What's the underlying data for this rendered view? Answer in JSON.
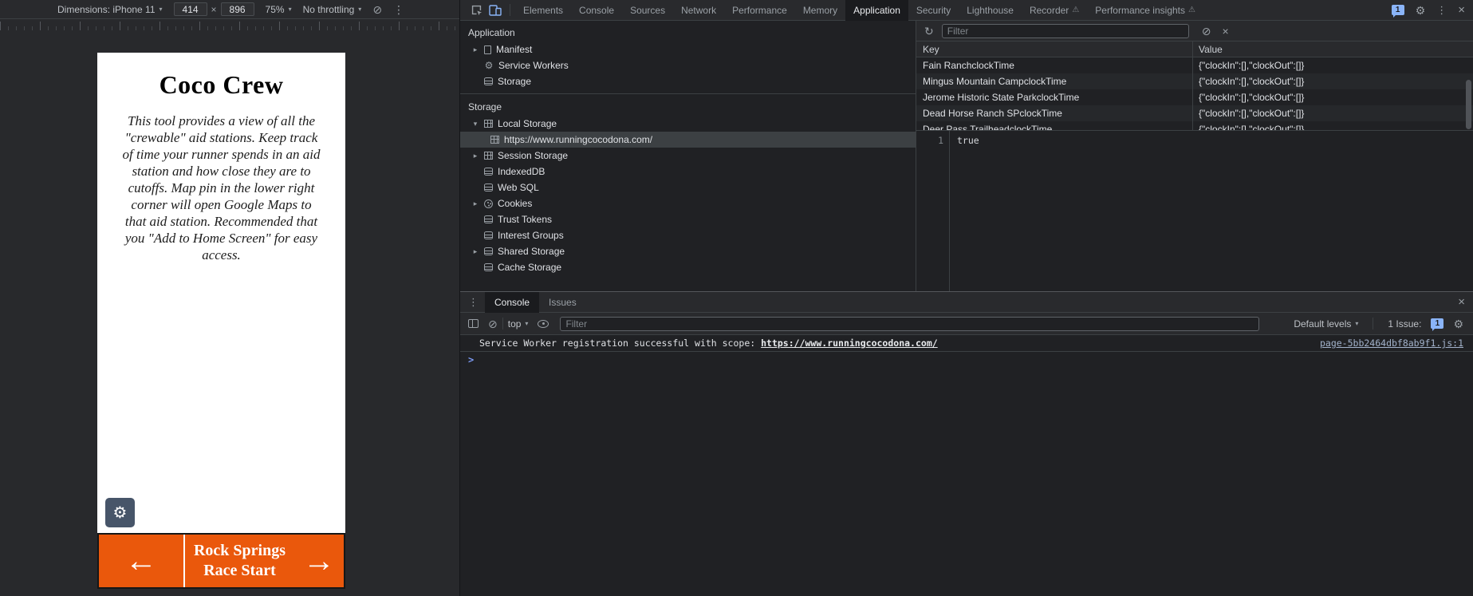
{
  "colors": {
    "accent_orange": "#ea580c",
    "settings_button": "#475569",
    "selection_gray": "#3c4043",
    "issue_badge_blue": "#8ab4f8"
  },
  "device_toolbar": {
    "dimensions_label": "Dimensions: iPhone 11",
    "width_value": "414",
    "multiply_sign": "×",
    "height_value": "896",
    "zoom_value": "75%",
    "throttling_value": "No throttling",
    "caret": "▾",
    "rotate_icon": "⊘",
    "menu_icon": "⋮"
  },
  "phone": {
    "title": "Coco Crew",
    "intro": "This tool provides a view of all the \"crewable\" aid stations. Keep track of time your runner spends in an aid station and how close they are to cutoffs. Map pin in the lower right corner will open Google Maps to that aid station. Recommended that you \"Add to Home Screen\" for easy access.",
    "settings_icon": "⚙",
    "footer": {
      "back_arrow": "←",
      "station_line1": "Rock Springs",
      "station_line2": "Race Start",
      "forward_arrow": "→"
    }
  },
  "devtools": {
    "tabbar": {
      "tabs": [
        "Elements",
        "Console",
        "Sources",
        "Network",
        "Performance",
        "Memory",
        "Application",
        "Security",
        "Lighthouse",
        "Recorder",
        "Performance insights"
      ],
      "active_tab": "Application",
      "experiment_icon": "⚠",
      "issue_count": "1",
      "settings_icon": "⚙",
      "menu_icon": "⋮",
      "close_icon": "×"
    },
    "app_panel": {
      "sidebar": {
        "sections": [
          {
            "title": "Application",
            "items": [
              {
                "arrow": "▸",
                "label": "Manifest",
                "icon": "manifest-icon"
              },
              {
                "label": "Service Workers",
                "icon": "gear-icon",
                "icon_glyph": "⚙"
              },
              {
                "label": "Storage",
                "icon": "database-icon"
              }
            ]
          },
          {
            "title": "Storage",
            "items": [
              {
                "arrow": "▾",
                "label": "Local Storage",
                "icon": "table-icon",
                "children": [
                  {
                    "label": "https://www.runningcocodona.com/",
                    "icon": "table-icon",
                    "selected": true
                  }
                ]
              },
              {
                "arrow": "▸",
                "label": "Session Storage",
                "icon": "table-icon"
              },
              {
                "label": "IndexedDB",
                "icon": "database-icon"
              },
              {
                "label": "Web SQL",
                "icon": "database-icon"
              },
              {
                "arrow": "▸",
                "label": "Cookies",
                "icon": "cookie-icon"
              },
              {
                "label": "Trust Tokens",
                "icon": "database-icon"
              },
              {
                "label": "Interest Groups",
                "icon": "database-icon"
              },
              {
                "arrow": "▸",
                "label": "Shared Storage",
                "icon": "database-icon"
              },
              {
                "label": "Cache Storage",
                "icon": "database-icon"
              }
            ]
          }
        ]
      },
      "toolbar": {
        "refresh_icon": "↻",
        "filter_placeholder": "Filter",
        "clear_icon": "⊘",
        "delete_icon": "×"
      },
      "grid": {
        "columns": [
          "Key",
          "Value"
        ],
        "rows": [
          {
            "key": "Fain RanchclockTime",
            "value": "{\"clockIn\":[],\"clockOut\":[]}"
          },
          {
            "key": "Mingus Mountain CampclockTime",
            "value": "{\"clockIn\":[],\"clockOut\":[]}"
          },
          {
            "key": "Jerome Historic State ParkclockTime",
            "value": "{\"clockIn\":[],\"clockOut\":[]}"
          },
          {
            "key": "Dead Horse Ranch SPclockTime",
            "value": "{\"clockIn\":[],\"clockOut\":[]}"
          },
          {
            "key": "Deer Pass TrailheadclockTime",
            "value": "{\"clockIn\":[],\"clockOut\":[]}"
          }
        ]
      },
      "preview": {
        "line_number": "1",
        "value": "true"
      }
    },
    "console": {
      "menu_icon": "⋮",
      "tabs": [
        "Console",
        "Issues"
      ],
      "active_tab": "Console",
      "close_icon": "×",
      "toolbar": {
        "clear_icon": "⊘",
        "context_value": "top",
        "caret": "▾",
        "filter_placeholder": "Filter",
        "levels_value": "Default levels",
        "issues_label": "1 Issue:",
        "issue_count": "1",
        "settings_icon": "⚙"
      },
      "message": {
        "text": "Service Worker registration successful with scope: ",
        "link": "https://www.runningcocodona.com/",
        "source": "page-5bb2464dbf8ab9f1.js:1"
      },
      "prompt_chevron": ">"
    }
  }
}
